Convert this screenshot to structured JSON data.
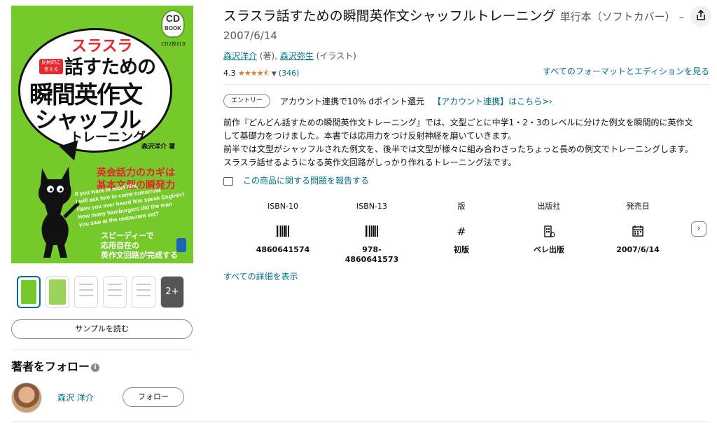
{
  "cover": {
    "cd_badge_big": "CD",
    "cd_badge_small": "BOOK",
    "cd_note": "CD2枚付き",
    "sura": "スラスラ",
    "hanshateki": "反射的に言える",
    "line1": "話すための",
    "line2": "瞬間英作文",
    "line3": "シャッフル",
    "line4": "トレーニング",
    "author": "森沢洋介 著",
    "red1": "英会話力のカギは",
    "red2": "基本文型の瞬発力",
    "eng": [
      "If you want to meet him,",
      "I will ask him to come tomorrow.",
      "Have you ever heard him speak English?",
      "How many hamburgers did the man",
      "you saw at the restaurant eat?"
    ],
    "white1": "スピーディーで",
    "white2": "応用自在の",
    "white3": "英作文回路が完成する"
  },
  "thumbs_more": "2+",
  "sample_button": "サンプルを読む",
  "follow": {
    "title": "著者をフォロー",
    "info": "i",
    "author_name": "森沢 洋介",
    "button": "フォロー"
  },
  "product": {
    "title": "スラスラ話すための瞬間英作文シャッフルトレーニング",
    "format": "単行本（ソフトカバー）",
    "date": " – 2007/6/14",
    "author1": "森沢洋介",
    "author1_role": " (著), ",
    "author2": "森沢弥生",
    "author2_role": " (イラスト)",
    "rating_value": "4.3",
    "stars": "★★★★⯪",
    "rating_count": "(346)",
    "all_formats": "すべてのフォーマットとエディションを見る"
  },
  "promo": {
    "pill": "エントリー",
    "text": "アカウント連携で10% dポイント還元",
    "link": "【アカウント連携】はこちら>›"
  },
  "description": [
    "前作『どんどん話すための瞬間英作文トレーニング』では、文型ごとに中学1・2・3のレベルに分けた例文を瞬間的に英作文",
    "して基礎力をつけました。本書では応用力をつけ反射神経を磨いていきます。",
    "前半では文型がシャッフルされた例文を、後半では文型が様々に組み合わさったちょっと長めの例文でトレーニングします。",
    "スラスラ話せるようになる英作文回路がしっかり作れるトレーニング法です。"
  ],
  "report_link": "この商品に関する問題を報告する",
  "details": [
    {
      "label": "ISBN-10",
      "icon": "barcode-icon",
      "value": "4860641574"
    },
    {
      "label": "ISBN-13",
      "icon": "barcode-icon",
      "value": "978-\n4860641573"
    },
    {
      "label": "版",
      "icon": "hash-icon",
      "value": "初版"
    },
    {
      "label": "出版社",
      "icon": "building-icon",
      "value": "ベレ出版"
    },
    {
      "label": "発売日",
      "icon": "calendar-icon",
      "value": "2007/6/14"
    }
  ],
  "see_all_details": "すべての詳細を表示",
  "colors": {
    "link": "#007185",
    "star": "#de7921",
    "cover_green": "#75c92b",
    "cover_red": "#e5272e"
  }
}
